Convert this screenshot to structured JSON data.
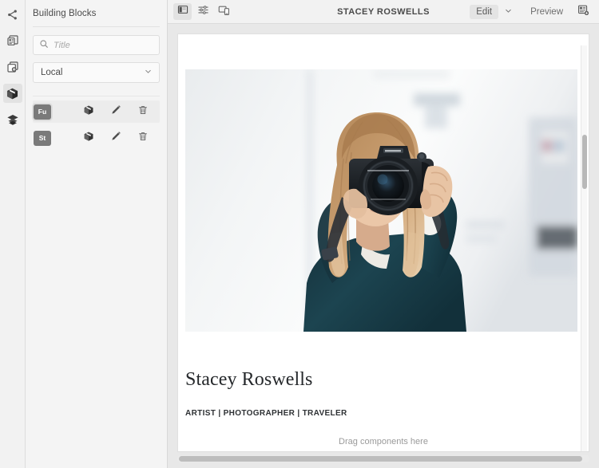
{
  "rail": {
    "items": [
      {
        "icon": "share-icon",
        "name": "rail-item-share",
        "active": false
      },
      {
        "icon": "page-layout-icon",
        "name": "rail-item-pages",
        "active": false
      },
      {
        "icon": "add-copy-icon",
        "name": "rail-item-duplicate",
        "active": false
      },
      {
        "icon": "package-icon",
        "name": "rail-item-building-blocks",
        "active": true
      },
      {
        "icon": "layers-icon",
        "name": "rail-item-layers",
        "active": false
      }
    ]
  },
  "panel": {
    "title": "Building Blocks",
    "search": {
      "placeholder": "Title",
      "value": "",
      "icon": "search-icon"
    },
    "scope_select": {
      "value": "Local",
      "icon": "chevron-down-icon"
    },
    "blocks": [
      {
        "badge": "Fu",
        "selected": true,
        "actions": [
          "package-icon",
          "pencil-icon",
          "trash-icon"
        ]
      },
      {
        "badge": "St",
        "selected": false,
        "actions": [
          "package-icon",
          "pencil-icon",
          "trash-icon"
        ]
      }
    ],
    "action_labels": {
      "insert": "Insert block",
      "edit": "Edit block",
      "delete": "Delete block"
    }
  },
  "toolbar": {
    "left_buttons": [
      {
        "icon": "panel-toggle-icon",
        "name": "toggle-panel-button",
        "active": true
      },
      {
        "icon": "settings-sliders-icon",
        "name": "settings-button",
        "active": false
      },
      {
        "icon": "responsive-preview-icon",
        "name": "responsive-button",
        "active": false
      }
    ],
    "title": "STACEY ROSWELLS",
    "edit_label": "Edit",
    "edit_caret_icon": "chevron-down-icon",
    "preview_label": "Preview",
    "last_icon": "page-settings-icon"
  },
  "canvas": {
    "hero": {
      "alt": "Woman holding a DSLR camera up to her face in front of a bright white blurred interior",
      "colors": {
        "background": "#eef1f3",
        "hair": "#b78a5c",
        "jacket": "#1d3f4a",
        "camera": "#1b1e22",
        "skin": "#e5c2a6"
      }
    },
    "heading": "Stacey Roswells",
    "subheading": "ARTIST | PHOTOGRAPHER | TRAVELER",
    "drop_hint": "Drag components here"
  },
  "colors": {
    "rail_bg": "#f2f2f2",
    "panel_bg": "#f4f4f4",
    "toolbar_bg": "#f2f2f2",
    "canvas_bg": "#e8e8e8",
    "page_bg": "#ffffff",
    "badge_bg": "#7a7a7a",
    "icon": "#5a5a5a"
  }
}
